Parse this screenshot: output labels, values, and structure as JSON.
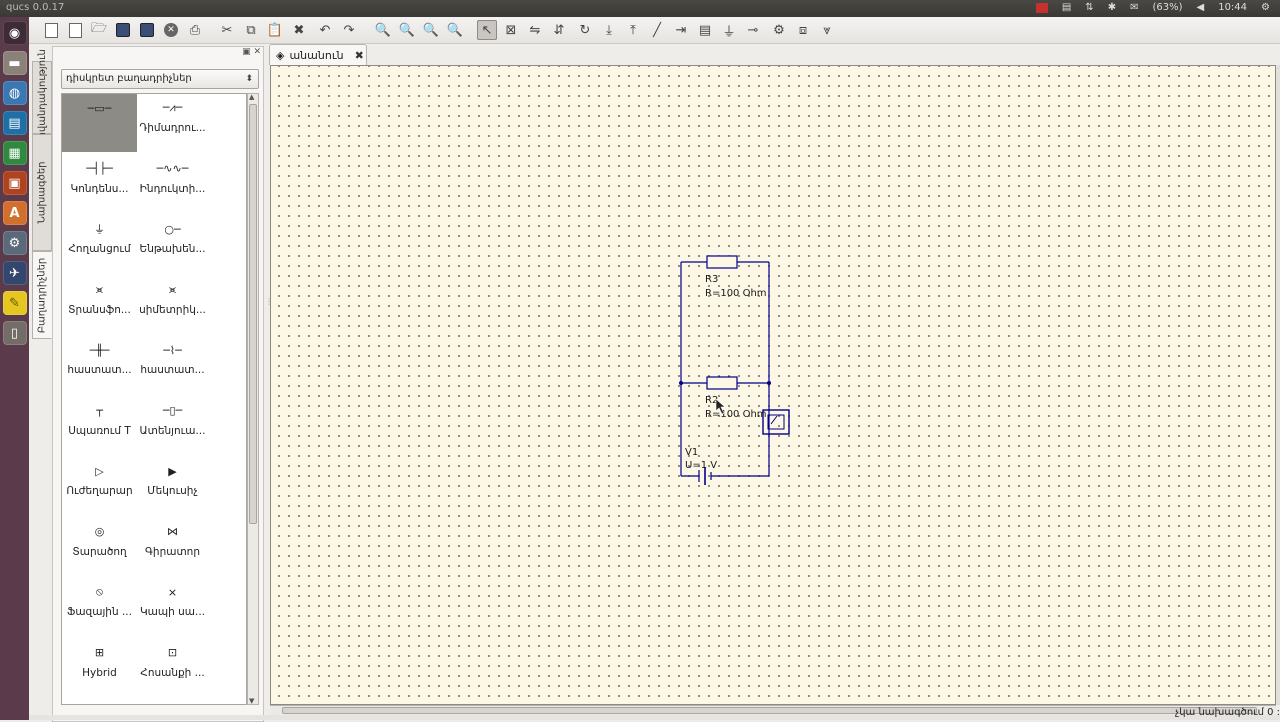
{
  "window": {
    "title": "qucs 0.0.17"
  },
  "system_tray": {
    "battery": "(63%)",
    "clock": "10:44"
  },
  "left_tabs": [
    "Բաղադրիչներ",
    "Նախագծեր",
    "Բովանդակություն"
  ],
  "dock": {
    "category_selected": "դիսկրետ բաղադրիչներ",
    "components": [
      {
        "label": "",
        "icon": "resistor-icon",
        "selected": true
      },
      {
        "label": "Դիմադրու...",
        "icon": "resistor-us-icon"
      },
      {
        "label": "Կոնդենս...",
        "icon": "capacitor-icon"
      },
      {
        "label": "Ինդուկտի...",
        "icon": "inductor-icon"
      },
      {
        "label": "Հողանցում",
        "icon": "ground-icon"
      },
      {
        "label": "Ենթախեն...",
        "icon": "subcircuit-port-icon"
      },
      {
        "label": "Տրանսֆո...",
        "icon": "transformer-icon"
      },
      {
        "label": "սիմետրիկ...",
        "icon": "symmetric-transformer-icon"
      },
      {
        "label": "հաստատ...",
        "icon": "dc-block-icon"
      },
      {
        "label": "հաստատ...",
        "icon": "dc-feed-icon"
      },
      {
        "label": "Սպառում T",
        "icon": "bias-tee-icon"
      },
      {
        "label": "Ատենյուա...",
        "icon": "attenuator-icon"
      },
      {
        "label": "Ուժեղարար",
        "icon": "amplifier-icon"
      },
      {
        "label": "Մեկուսիչ",
        "icon": "isolator-icon"
      },
      {
        "label": "Տարածող",
        "icon": "circulator-icon"
      },
      {
        "label": "Գիրատոր",
        "icon": "gyrator-icon"
      },
      {
        "label": "Ֆազային ...",
        "icon": "phase-shifter-icon"
      },
      {
        "label": "Կապի սա...",
        "icon": "coupler-icon"
      },
      {
        "label": "Hybrid",
        "icon": "hybrid-icon"
      },
      {
        "label": "Հոսանքի ...",
        "icon": "current-probe-icon"
      }
    ]
  },
  "document_tab": {
    "label": "անանուն",
    "close": "✖"
  },
  "schematic": {
    "components": [
      {
        "name": "R3",
        "value": "R=100 Ohm"
      },
      {
        "name": "R2",
        "value": "R=100 Ohm"
      },
      {
        "name": "V1",
        "value": "U=1 V"
      }
    ]
  },
  "status": {
    "text": "չկա նախագծում 0 :"
  }
}
